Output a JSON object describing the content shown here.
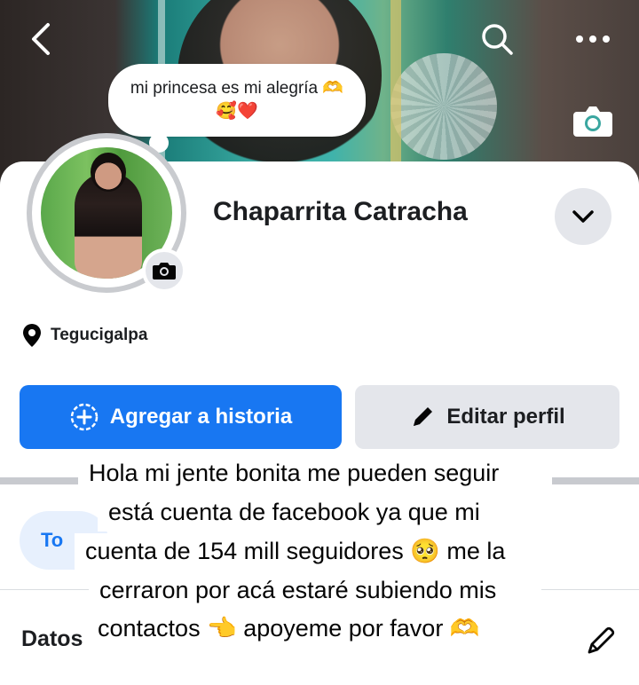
{
  "cover": {
    "back_icon": "chevron-left-icon",
    "search_icon": "search-icon",
    "more_icon": "more-dots-icon",
    "camera_icon": "camera-icon"
  },
  "note": {
    "text": "mi princesa es mi alegría 🫶",
    "emoji": "🥰❤️"
  },
  "profile": {
    "name": "Chaparrita Catracha",
    "location": "Tegucigalpa"
  },
  "actions": {
    "add_story": "Agregar a historia",
    "edit_profile": "Editar perfil"
  },
  "tabs": {
    "first": "To"
  },
  "section": {
    "title": "Datos"
  },
  "caption": {
    "line1": "Hola mi jente bonita me pueden seguir",
    "line2": "está cuenta de facebook ya que mi",
    "line3": "cuenta de 154 mill seguidores 🥺 me la",
    "line4": "cerraron por acá estaré subiendo mis",
    "line5": "contactos 👈  apoyeme por favor 🫶"
  },
  "colors": {
    "accent": "#1877f2",
    "button_gray": "#e4e6eb",
    "text": "#1c1e21"
  }
}
